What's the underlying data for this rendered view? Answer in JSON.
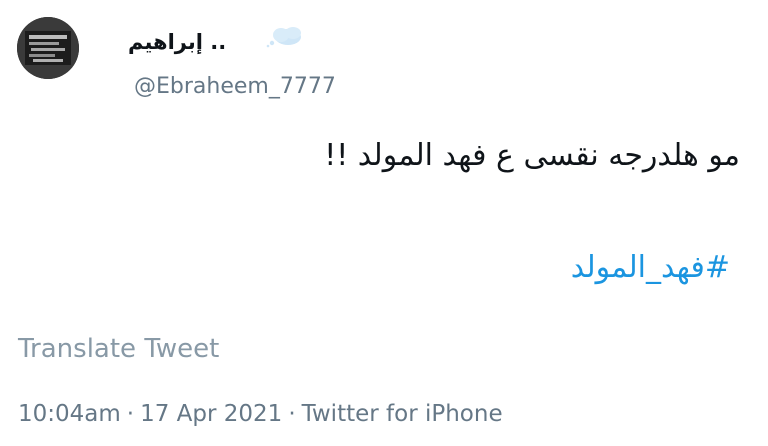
{
  "user": {
    "display_name": ".. إبراهيم",
    "handle": "@Ebraheem_7777",
    "avatar_icon": "avatar-image",
    "emoji_icon": "cloud-icon"
  },
  "tweet": {
    "text": "مو هلدرجه نقسى ع فهد المولد !!",
    "hashtag": "#فهد_المولد"
  },
  "actions": {
    "translate_label": "Translate Tweet"
  },
  "meta": {
    "time": "10:04am",
    "separator": "·",
    "date": "17 Apr 2021",
    "source": "Twitter for iPhone"
  },
  "colors": {
    "link": "#1b95e0",
    "text": "#0f1419",
    "secondary": "#657786",
    "muted": "#8899a6"
  }
}
